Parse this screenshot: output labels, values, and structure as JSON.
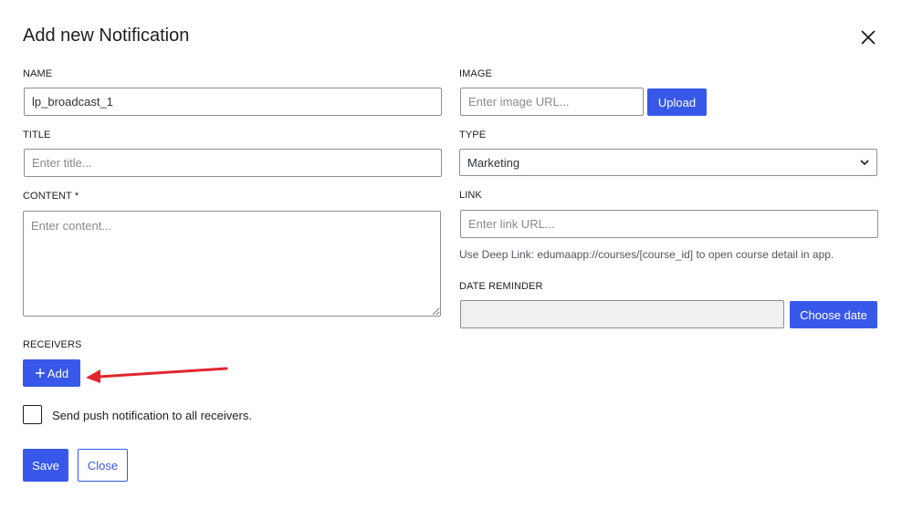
{
  "dialog": {
    "title": "Add new Notification"
  },
  "name": {
    "label": "NAME",
    "value": "lp_broadcast_1"
  },
  "image": {
    "label": "IMAGE",
    "placeholder": "Enter image URL...",
    "upload_label": "Upload"
  },
  "title_field": {
    "label": "TITLE",
    "placeholder": "Enter title..."
  },
  "type": {
    "label": "TYPE",
    "value": "Marketing"
  },
  "content": {
    "label": "CONTENT *",
    "placeholder": "Enter content..."
  },
  "link": {
    "label": "LINK",
    "placeholder": "Enter link URL...",
    "help": "Use Deep Link: edumaapp://courses/[course_id] to open course detail in app."
  },
  "date_reminder": {
    "label": "DATE REMINDER",
    "choose_label": "Choose date"
  },
  "receivers": {
    "label": "RECEIVERS",
    "add_label": "Add"
  },
  "push_all": {
    "label": "Send push notification to all receivers."
  },
  "footer": {
    "save_label": "Save",
    "close_label": "Close"
  },
  "colors": {
    "primary": "#3858e9",
    "annotation_arrow": "#e0262c"
  }
}
